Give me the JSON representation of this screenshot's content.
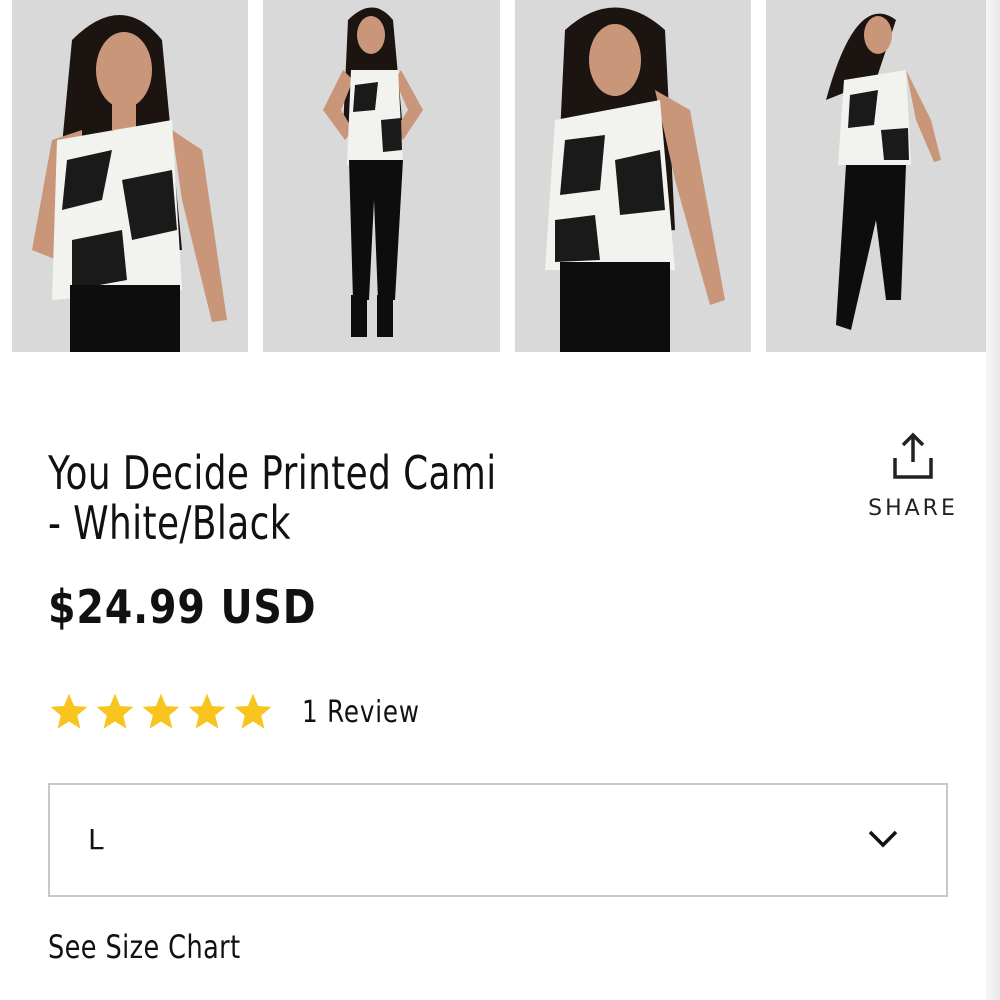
{
  "product": {
    "title": "You Decide Printed Cami - White/Black",
    "price": "$24.99 USD",
    "rating": 5,
    "rating_max": 5,
    "review_count_label": "1 Review"
  },
  "share": {
    "label": "SHARE",
    "icon": "share-upload-icon"
  },
  "size_select": {
    "selected": "L",
    "icon": "chevron-down-icon"
  },
  "links": {
    "size_chart": "See Size Chart"
  },
  "colors": {
    "star": "#F7C51E",
    "text": "#111111",
    "border": "#C8C8C8",
    "photo_bg": "#D9D9D9"
  }
}
